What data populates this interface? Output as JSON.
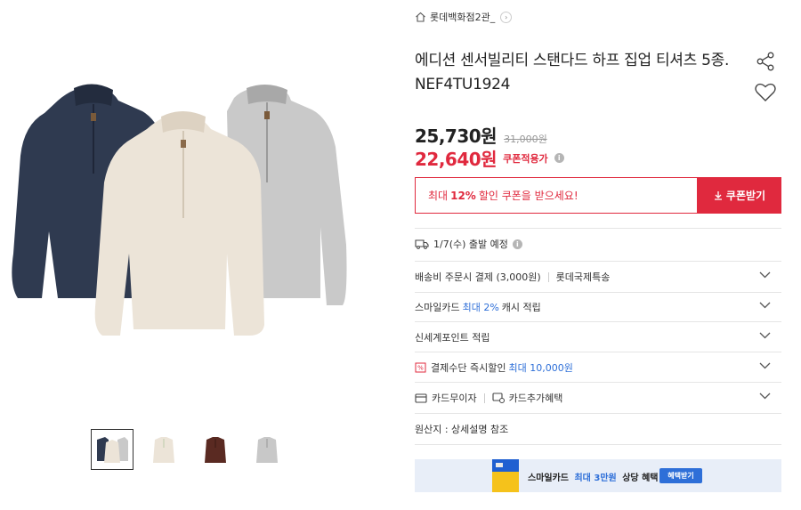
{
  "store": {
    "name": "롯데백화점2관_"
  },
  "product": {
    "title": "에디션 센서빌리티 스탠다드 하프 집업 티셔츠 5종. NEF4TU1924",
    "price": "25,730원",
    "original_price": "31,000원",
    "coupon_price": "22,640원",
    "coupon_label": "쿠폰적용가"
  },
  "coupon": {
    "prefix": "최대",
    "percent": "12%",
    "suffix": "할인 쿠폰을 받으세요!",
    "button_label": "쿠폰받기"
  },
  "shipping": {
    "text": "1/7(수) 출발 예정"
  },
  "accordion": {
    "delivery": {
      "text": "배송비 주문시 결제 (3,000원)",
      "carrier": "롯데국제특송"
    },
    "smile_card": {
      "prefix": "스마일카드",
      "highlight": "최대 2%",
      "suffix": "캐시 적립"
    },
    "shinsegae": {
      "text": "신세계포인트 적립"
    },
    "payment": {
      "prefix": "결제수단 즉시할인",
      "highlight": "최대 10,000원"
    },
    "card_interest": {
      "text": "카드무이자"
    },
    "card_benefit": {
      "text": "카드추가혜택"
    }
  },
  "origin": {
    "text": "원산지 : 상세설명 참조"
  },
  "banner": {
    "prefix": "스마일카드",
    "highlight": "최대 3만원",
    "suffix": "상당 혜택",
    "button_label": "혜택받기"
  },
  "colors": {
    "accent_red": "#e0293e",
    "accent_blue": "#2e6fd8",
    "navy": "#2f3a50",
    "beige": "#ece4d8",
    "gray": "#c8c8c8",
    "brown": "#5a2a22"
  },
  "icons": [
    "home-icon",
    "chevron-right-icon",
    "share-icon",
    "heart-icon",
    "info-icon",
    "download-icon",
    "truck-icon",
    "chevron-down-icon",
    "discount-tag-icon",
    "card-icon",
    "card-plus-icon"
  ]
}
